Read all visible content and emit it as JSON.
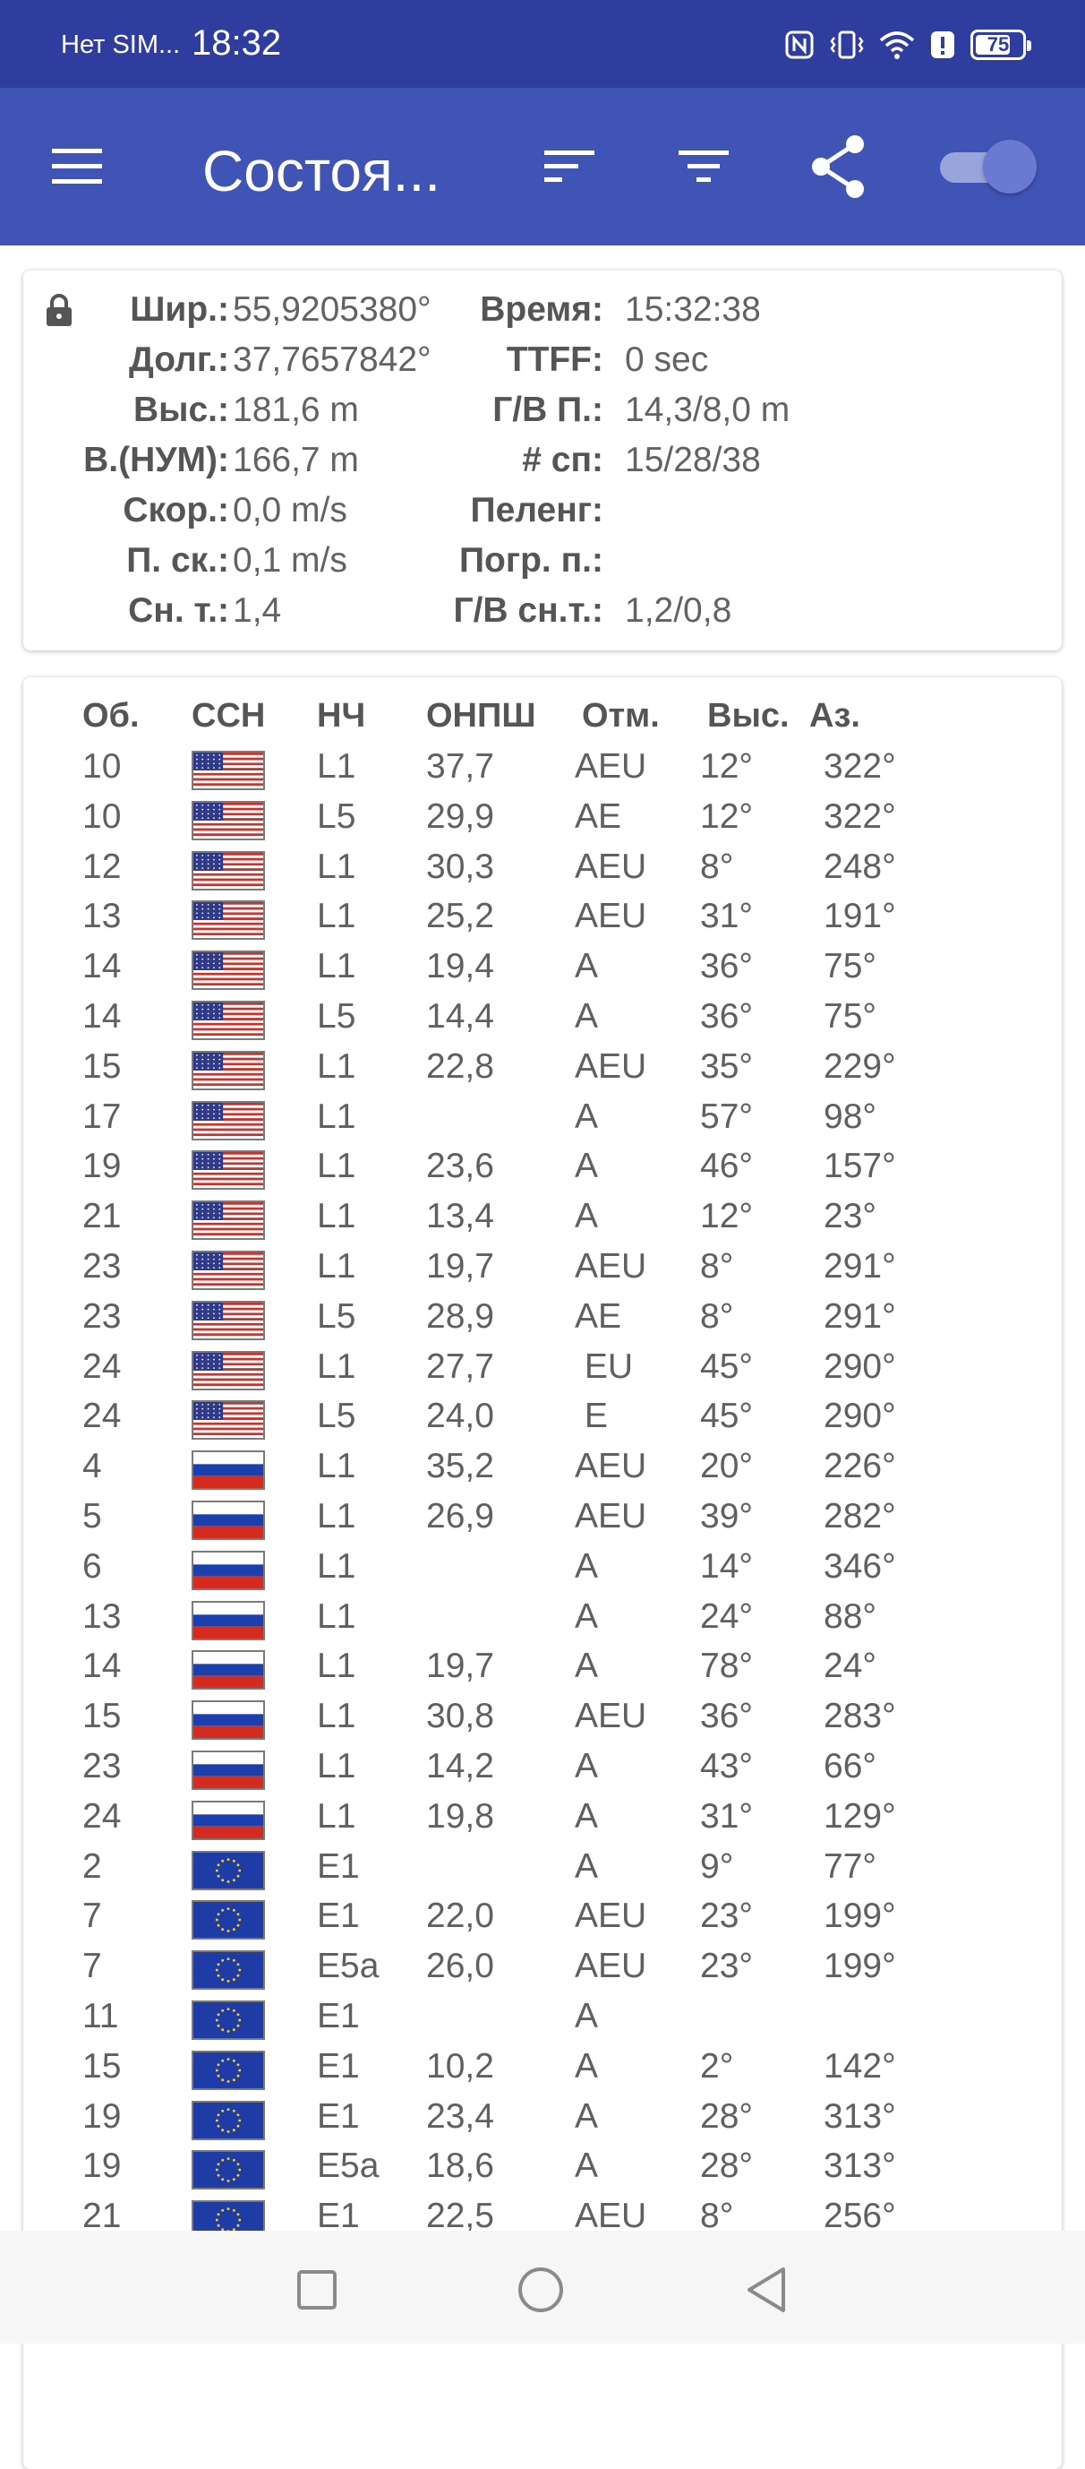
{
  "status_bar": {
    "carrier": "Нет SIM...",
    "time": "18:32",
    "battery_level": "75",
    "battery_fraction": 0.75,
    "icons": [
      "nfc-icon",
      "vibrate-icon",
      "wifi-icon",
      "alert-icon",
      "battery-icon"
    ]
  },
  "app_bar": {
    "title": "Состоя...",
    "icons": [
      "menu-icon",
      "sort-icon",
      "filter-icon",
      "share-icon",
      "toggle-switch"
    ],
    "toggle_on": true,
    "color": "#4054b6"
  },
  "info": {
    "left": [
      {
        "label": "Шир.:",
        "value": "55,9205380°"
      },
      {
        "label": "Долг.:",
        "value": "37,7657842°"
      },
      {
        "label": "Выс.:",
        "value": "181,6 m"
      },
      {
        "label": "В.(НУМ):",
        "value": "166,7 m"
      },
      {
        "label": "Скор.:",
        "value": "0,0 m/s"
      },
      {
        "label": "П. ск.:",
        "value": "0,1 m/s"
      },
      {
        "label": "Сн. т.:",
        "value": "1,4"
      }
    ],
    "right": [
      {
        "label": "Время:",
        "value": "15:32:38"
      },
      {
        "label": "TTFF:",
        "value": "0 sec"
      },
      {
        "label": "Г/В П.:",
        "value": "14,3/8,0 m"
      },
      {
        "label": "# сп:",
        "value": "15/28/38"
      },
      {
        "label": "Пеленг:",
        "value": ""
      },
      {
        "label": "Погр. п.:",
        "value": ""
      },
      {
        "label": "Г/В сн.т.:",
        "value": "1,2/0,8"
      }
    ]
  },
  "table": {
    "headers": [
      "Об.",
      "ССН",
      "НЧ",
      "ОНПШ",
      "Отм.",
      "Выс.",
      "Аз."
    ],
    "rows": [
      {
        "id": "10",
        "flag": "us",
        "band": "L1",
        "cn0": "37,7",
        "flags": "AEU",
        "elev": "12°",
        "az": "322°"
      },
      {
        "id": "10",
        "flag": "us",
        "band": "L5",
        "cn0": "29,9",
        "flags": "AE",
        "elev": "12°",
        "az": "322°"
      },
      {
        "id": "12",
        "flag": "us",
        "band": "L1",
        "cn0": "30,3",
        "flags": "AEU",
        "elev": "8°",
        "az": "248°"
      },
      {
        "id": "13",
        "flag": "us",
        "band": "L1",
        "cn0": "25,2",
        "flags": "AEU",
        "elev": "31°",
        "az": "191°"
      },
      {
        "id": "14",
        "flag": "us",
        "band": "L1",
        "cn0": "19,4",
        "flags": "A",
        "elev": "36°",
        "az": "75°"
      },
      {
        "id": "14",
        "flag": "us",
        "band": "L5",
        "cn0": "14,4",
        "flags": "A",
        "elev": "36°",
        "az": "75°"
      },
      {
        "id": "15",
        "flag": "us",
        "band": "L1",
        "cn0": "22,8",
        "flags": "AEU",
        "elev": "35°",
        "az": "229°"
      },
      {
        "id": "17",
        "flag": "us",
        "band": "L1",
        "cn0": "",
        "flags": "A",
        "elev": "57°",
        "az": "98°"
      },
      {
        "id": "19",
        "flag": "us",
        "band": "L1",
        "cn0": "23,6",
        "flags": "A",
        "elev": "46°",
        "az": "157°"
      },
      {
        "id": "21",
        "flag": "us",
        "band": "L1",
        "cn0": "13,4",
        "flags": "A",
        "elev": "12°",
        "az": "23°"
      },
      {
        "id": "23",
        "flag": "us",
        "band": "L1",
        "cn0": "19,7",
        "flags": "AEU",
        "elev": "8°",
        "az": "291°"
      },
      {
        "id": "23",
        "flag": "us",
        "band": "L5",
        "cn0": "28,9",
        "flags": "AE",
        "elev": "8°",
        "az": "291°"
      },
      {
        "id": "24",
        "flag": "us",
        "band": "L1",
        "cn0": "27,7",
        "flags": " EU",
        "elev": "45°",
        "az": "290°"
      },
      {
        "id": "24",
        "flag": "us",
        "band": "L5",
        "cn0": "24,0",
        "flags": " E",
        "elev": "45°",
        "az": "290°"
      },
      {
        "id": "4",
        "flag": "ru",
        "band": "L1",
        "cn0": "35,2",
        "flags": "AEU",
        "elev": "20°",
        "az": "226°"
      },
      {
        "id": "5",
        "flag": "ru",
        "band": "L1",
        "cn0": "26,9",
        "flags": "AEU",
        "elev": "39°",
        "az": "282°"
      },
      {
        "id": "6",
        "flag": "ru",
        "band": "L1",
        "cn0": "",
        "flags": "A",
        "elev": "14°",
        "az": "346°"
      },
      {
        "id": "13",
        "flag": "ru",
        "band": "L1",
        "cn0": "",
        "flags": "A",
        "elev": "24°",
        "az": "88°"
      },
      {
        "id": "14",
        "flag": "ru",
        "band": "L1",
        "cn0": "19,7",
        "flags": "A",
        "elev": "78°",
        "az": "24°"
      },
      {
        "id": "15",
        "flag": "ru",
        "band": "L1",
        "cn0": "30,8",
        "flags": "AEU",
        "elev": "36°",
        "az": "283°"
      },
      {
        "id": "23",
        "flag": "ru",
        "band": "L1",
        "cn0": "14,2",
        "flags": "A",
        "elev": "43°",
        "az": "66°"
      },
      {
        "id": "24",
        "flag": "ru",
        "band": "L1",
        "cn0": "19,8",
        "flags": "A",
        "elev": "31°",
        "az": "129°"
      },
      {
        "id": "2",
        "flag": "eu",
        "band": "E1",
        "cn0": "",
        "flags": "A",
        "elev": "9°",
        "az": "77°"
      },
      {
        "id": "7",
        "flag": "eu",
        "band": "E1",
        "cn0": "22,0",
        "flags": "AEU",
        "elev": "23°",
        "az": "199°"
      },
      {
        "id": "7",
        "flag": "eu",
        "band": "E5a",
        "cn0": "26,0",
        "flags": "AEU",
        "elev": "23°",
        "az": "199°"
      },
      {
        "id": "11",
        "flag": "eu",
        "band": "E1",
        "cn0": "",
        "flags": "A",
        "elev": "",
        "az": ""
      },
      {
        "id": "15",
        "flag": "eu",
        "band": "E1",
        "cn0": "10,2",
        "flags": "A",
        "elev": "2°",
        "az": "142°"
      },
      {
        "id": "19",
        "flag": "eu",
        "band": "E1",
        "cn0": "23,4",
        "flags": "A",
        "elev": "28°",
        "az": "313°"
      },
      {
        "id": "19",
        "flag": "eu",
        "band": "E5a",
        "cn0": "18,6",
        "flags": "A",
        "elev": "28°",
        "az": "313°"
      },
      {
        "id": "21",
        "flag": "eu",
        "band": "E1",
        "cn0": "22,5",
        "flags": "AEU",
        "elev": "8°",
        "az": "256°"
      }
    ]
  },
  "nav_bar": {
    "icons": [
      "recents-square-icon",
      "home-circle-icon",
      "back-triangle-icon"
    ]
  }
}
